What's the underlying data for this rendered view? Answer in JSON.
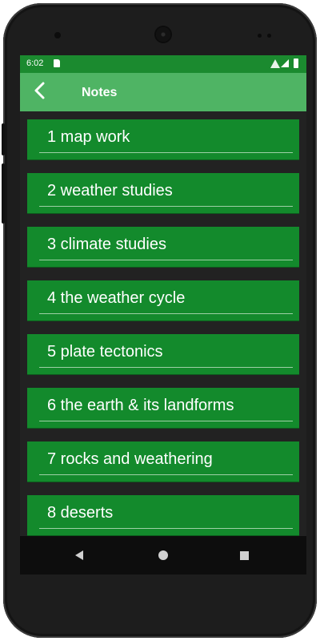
{
  "status_bar": {
    "time": "6:02"
  },
  "app_bar": {
    "title": "Notes"
  },
  "notes": [
    {
      "label": "1 map work"
    },
    {
      "label": "2 weather studies"
    },
    {
      "label": "3 climate studies"
    },
    {
      "label": "4 the weather cycle"
    },
    {
      "label": "5 plate tectonics"
    },
    {
      "label": "6 the earth & its landforms"
    },
    {
      "label": "7 rocks and weathering"
    },
    {
      "label": "8 deserts"
    }
  ],
  "colors": {
    "status_bar": "#1b8a2f",
    "app_bar": "#4fb464",
    "item": "#138a2c",
    "background": "#222222"
  },
  "icons": {
    "back": "back-arrow-icon",
    "nav_back": "nav-back-icon",
    "nav_home": "nav-home-icon",
    "nav_recent": "nav-recents-icon"
  }
}
